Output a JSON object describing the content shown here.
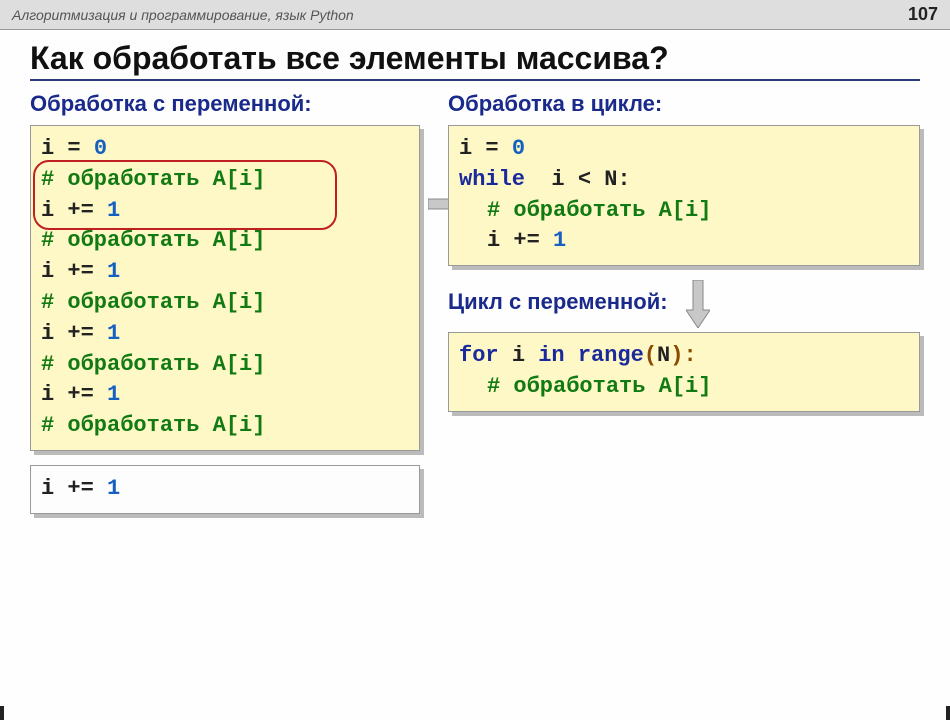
{
  "header": {
    "title": "Алгоритмизация и программирование, язык Python",
    "page_num": "107"
  },
  "slide": {
    "title": "Как обработать все элементы массива?",
    "left_heading": "Обработка с переменной:",
    "right_heading": "Обработка в цикле:",
    "cycle_heading": "Цикл с переменной:",
    "code": {
      "assign_i": "i = ",
      "zero": "0",
      "one": "1",
      "comment_process": "# обработать A[i]",
      "inc_i": "i += ",
      "while_kw": "while",
      "while_cond": "i < N:",
      "for_kw": "for",
      "for_i": "i",
      "in_kw": "in",
      "range_kw": "range",
      "open_paren": "(",
      "n_var": "N",
      "close_paren_colon": "):"
    }
  }
}
